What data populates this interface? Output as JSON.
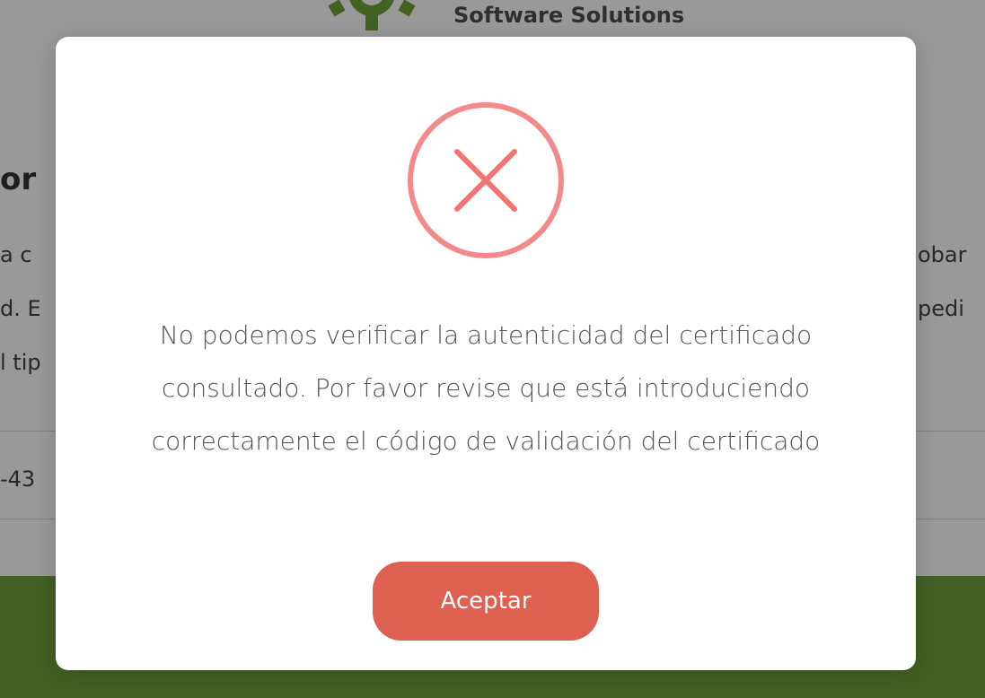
{
  "background": {
    "logo_text": "Software Solutions",
    "title_fragment": "or",
    "text_lines_left": [
      "a c",
      "d. E",
      "l tip"
    ],
    "text_lines_right": [
      "obar",
      "pedi"
    ],
    "code_fragment": "-43",
    "brand_green": "#6fa23b"
  },
  "modal": {
    "icon": "error-x-icon",
    "icon_color": "#f27474",
    "message": "No podemos verificar la autenticidad del certificado consultado. Por favor revise que está introduciendo correctamente el código de validación del certificado",
    "accept_label": "Aceptar",
    "button_color": "#dd6050"
  }
}
